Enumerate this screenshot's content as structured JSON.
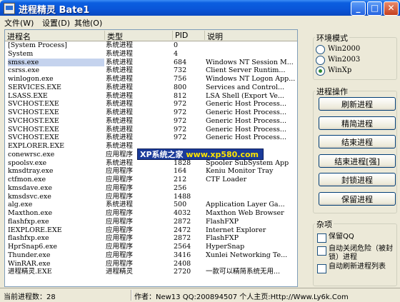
{
  "window": {
    "title": "进程精灵 Bate1"
  },
  "menu": [
    "文件(W)",
    "设置(D)",
    "其他(O)"
  ],
  "list": {
    "columns": [
      "进程名",
      "类型",
      "PID",
      "说明"
    ],
    "rows": [
      {
        "name": "[System Process]",
        "type": "系统进程",
        "pid": "0",
        "desc": ""
      },
      {
        "name": "System",
        "type": "系统进程",
        "pid": "4",
        "desc": ""
      },
      {
        "name": "smss.exe",
        "type": "系统进程",
        "pid": "684",
        "desc": "Windows NT Session M..."
      },
      {
        "name": "csrss.exe",
        "type": "系统进程",
        "pid": "732",
        "desc": "Client Server Runtim..."
      },
      {
        "name": "winlogon.exe",
        "type": "系统进程",
        "pid": "756",
        "desc": "Windows NT Logon App..."
      },
      {
        "name": "SERVICES.EXE",
        "type": "系统进程",
        "pid": "800",
        "desc": "Services and Control..."
      },
      {
        "name": "LSASS.EXE",
        "type": "系统进程",
        "pid": "812",
        "desc": "LSA Shell (Export Ve..."
      },
      {
        "name": "SVCHOST.EXE",
        "type": "系统进程",
        "pid": "972",
        "desc": "Generic Host Process..."
      },
      {
        "name": "SVCHOST.EXE",
        "type": "系统进程",
        "pid": "972",
        "desc": "Generic Host Process..."
      },
      {
        "name": "SVCHOST.EXE",
        "type": "系统进程",
        "pid": "972",
        "desc": "Generic Host Process..."
      },
      {
        "name": "SVCHOST.EXE",
        "type": "系统进程",
        "pid": "972",
        "desc": "Generic Host Process..."
      },
      {
        "name": "SVCHOST.EXE",
        "type": "系统进程",
        "pid": "972",
        "desc": "Generic Host Process..."
      },
      {
        "name": "EXPLORER.EXE",
        "type": "系统进程",
        "pid": "",
        "desc": ""
      },
      {
        "name": "conewrsc.exe",
        "type": "应用程序",
        "pid": "",
        "desc": ""
      },
      {
        "name": "spoolsv.exe",
        "type": "系统进程",
        "pid": "1828",
        "desc": "Spooler SubSystem App"
      },
      {
        "name": "kmsdtray.exe",
        "type": "应用程序",
        "pid": "164",
        "desc": "Keniu Monitor Tray"
      },
      {
        "name": "ctfmon.exe",
        "type": "应用程序",
        "pid": "212",
        "desc": "CTF Loader"
      },
      {
        "name": "kmsdave.exe",
        "type": "应用程序",
        "pid": "256",
        "desc": ""
      },
      {
        "name": "kmsdsvc.exe",
        "type": "应用程序",
        "pid": "1488",
        "desc": ""
      },
      {
        "name": "alg.exe",
        "type": "系统进程",
        "pid": "500",
        "desc": "Application Layer Ga..."
      },
      {
        "name": "Maxthon.exe",
        "type": "应用程序",
        "pid": "4032",
        "desc": "Maxthon Web Browser"
      },
      {
        "name": "flashfxp.exe",
        "type": "应用程序",
        "pid": "2872",
        "desc": "FlashFXP"
      },
      {
        "name": "IEXPLORE.EXE",
        "type": "应用程序",
        "pid": "2472",
        "desc": "Internet Explorer"
      },
      {
        "name": "flashfxp.exe",
        "type": "应用程序",
        "pid": "2872",
        "desc": "FlashFXP"
      },
      {
        "name": "HprSnap6.exe",
        "type": "应用程序",
        "pid": "2564",
        "desc": "HyperSnap"
      },
      {
        "name": "Thunder.exe",
        "type": "应用程序",
        "pid": "3416",
        "desc": "Xunlei Networking Te..."
      },
      {
        "name": "WinRAR.exe",
        "type": "应用程序",
        "pid": "2408",
        "desc": ""
      },
      {
        "name": "进程精灵.EXE",
        "type": "进程精灵",
        "pid": "2720",
        "desc": "一款可以精简系统无用..."
      }
    ],
    "selected_index": 2
  },
  "watermark": {
    "prefix": "XP系统之家",
    "url": "www.xp580.com"
  },
  "env": {
    "label": "环境模式",
    "options": [
      "Win2000",
      "Win2003",
      "WinXp"
    ],
    "selected": 2
  },
  "ops": {
    "label": "进程操作",
    "buttons": [
      "刷新进程",
      "精简进程",
      "结束进程",
      "结束进程[强]",
      "封锁进程",
      "保留进程"
    ]
  },
  "misc": {
    "label": "杂项",
    "checks": [
      "保留QQ",
      "自动关闭危险（被封锁）进程",
      "自动刷新进程列表"
    ]
  },
  "status": {
    "count": "当前进程数：28",
    "info": "作者：New13 QQ:200894507 个人主页:Http://Www.Ly6k.Com"
  }
}
